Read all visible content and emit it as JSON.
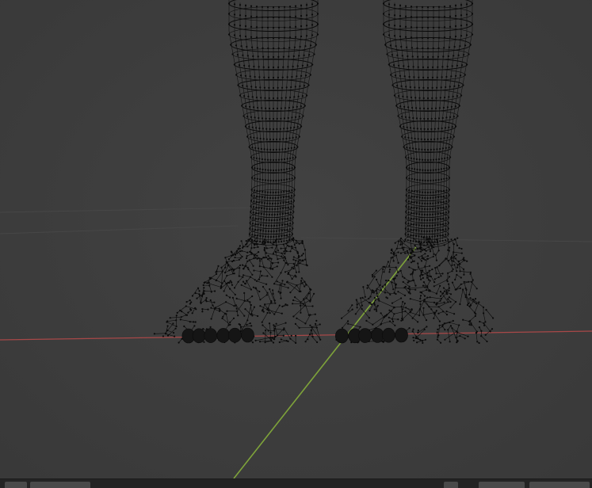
{
  "viewport": {
    "mode": "edit-mode-wireframe",
    "background_color": "#3d3d3d",
    "mesh_color": "#0a0a0a",
    "x_axis_color": "#b04a4a",
    "y_axis_color": "#7ea33a"
  },
  "bottom_bar": {
    "background_color": "#242424",
    "tab_color": "#4a4a4a"
  }
}
